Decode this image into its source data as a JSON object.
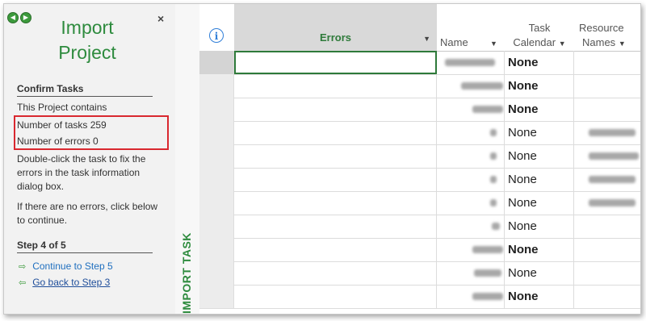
{
  "pane": {
    "title_line1": "Import",
    "title_line2": "Project",
    "close_glyph": "×",
    "confirm_heading": "Confirm Tasks",
    "contains_text": "This Project contains",
    "tasks_text": "Number of tasks   259",
    "errors_text": "Number of errors 0",
    "instructions": "Double-click the task to fix the errors in the task information dialog box.",
    "no_errors_text": "If there are no errors, click below to continue.",
    "step_heading": "Step 4 of 5",
    "continue_link": "Continue to Step 5",
    "back_link": "Go back to Step 3"
  },
  "band_label": "IMPORT TASK",
  "grid": {
    "info_glyph": "i",
    "col_errors": "Errors",
    "col_name": "Name",
    "col_cal_1": "Task",
    "col_cal_2": "Calendar",
    "col_res_1": "Resource",
    "col_res_2": "Names",
    "dropdown_glyph": "▼",
    "calendar_values": [
      "None",
      "None",
      "None",
      "None",
      "None",
      "None",
      "None",
      "None",
      "None",
      "None",
      "None"
    ],
    "calendar_bold": [
      true,
      true,
      true,
      false,
      false,
      false,
      false,
      false,
      true,
      false,
      true
    ]
  },
  "colors": {
    "accent_green": "#2e8b3e",
    "highlight_red": "#d9282f",
    "link_blue": "#1f6fbf"
  }
}
